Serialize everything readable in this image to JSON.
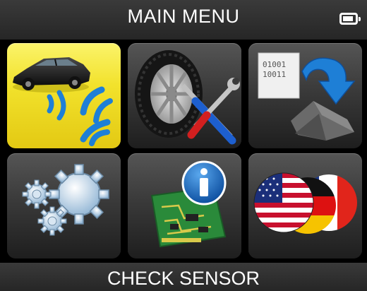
{
  "header": {
    "title": "MAIN MENU",
    "battery_icon": "battery-icon",
    "battery_level": 0.85
  },
  "menu": {
    "selected_index": 0,
    "tiles": [
      {
        "id": "check-sensor",
        "icon": "car-sensor-signal-icon"
      },
      {
        "id": "service-tools",
        "icon": "tire-tools-icon"
      },
      {
        "id": "program-sensor",
        "icon": "sensor-programming-icon"
      },
      {
        "id": "settings",
        "icon": "gears-icon"
      },
      {
        "id": "info",
        "icon": "info-circuit-board-icon"
      },
      {
        "id": "language",
        "icon": "flags-icon"
      }
    ]
  },
  "status": {
    "label": "CHECK SENSOR"
  },
  "colors": {
    "selected_tile": "#f2e22c",
    "tile": "#3a3a3a",
    "signal": "#1e7fd6",
    "bar": "#2e2e2e"
  }
}
